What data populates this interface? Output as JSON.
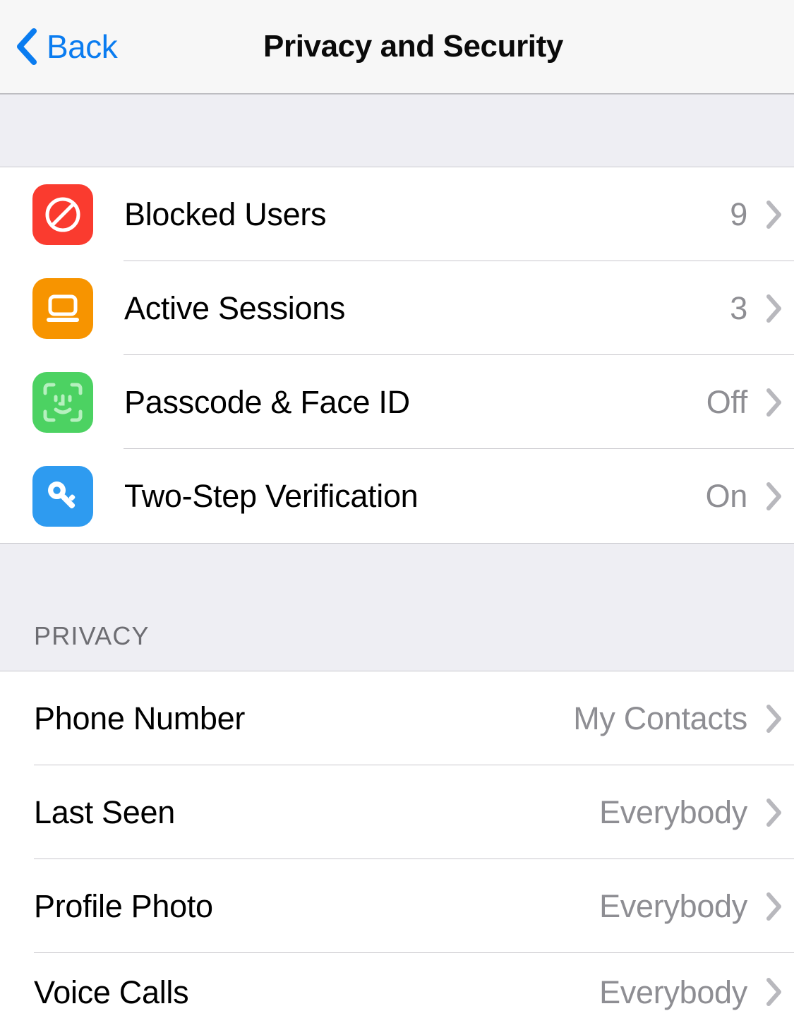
{
  "navbar": {
    "back_label": "Back",
    "back_icon": "chevron-left-icon",
    "title": "Privacy and Security",
    "back_color": "#0a7cf0",
    "background": "#f7f7f7"
  },
  "security_section": {
    "rows": [
      {
        "label": "Blocked Users",
        "value": "9",
        "icon": "block-circle-slash-icon",
        "icon_color": "#fa3b2f",
        "accessory": "chevron-right-icon"
      },
      {
        "label": "Active Sessions",
        "value": "3",
        "icon": "laptop-icon",
        "icon_color": "#f79400",
        "accessory": "chevron-right-icon"
      },
      {
        "label": "Passcode & Face ID",
        "value": "Off",
        "icon": "face-id-icon",
        "icon_color": "#4cd262",
        "accessory": "chevron-right-icon"
      },
      {
        "label": "Two-Step Verification",
        "value": "On",
        "icon": "key-icon",
        "icon_color": "#2e9bf0",
        "accessory": "chevron-right-icon"
      }
    ]
  },
  "privacy_section": {
    "header": "PRIVACY",
    "rows": [
      {
        "label": "Phone Number",
        "value": "My Contacts",
        "accessory": "chevron-right-icon"
      },
      {
        "label": "Last Seen",
        "value": "Everybody",
        "accessory": "chevron-right-icon"
      },
      {
        "label": "Profile Photo",
        "value": "Everybody",
        "accessory": "chevron-right-icon"
      },
      {
        "label": "Voice Calls",
        "value": "Everybody",
        "accessory": "chevron-right-icon"
      }
    ]
  },
  "colors": {
    "separator": "#c8c7cc",
    "group_background": "#eeeef3",
    "value_text": "#8e8e93",
    "header_text": "#6d6d72"
  }
}
